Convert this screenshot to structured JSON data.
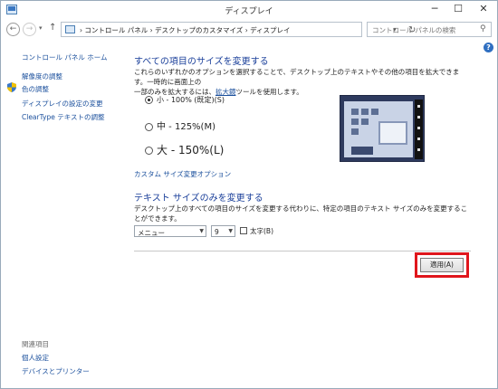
{
  "window": {
    "title": "ディスプレイ",
    "controls": {
      "minimize": "─",
      "maximize": "☐",
      "close": "✕"
    }
  },
  "nav": {
    "back": "←",
    "forward": "→",
    "up": "↑",
    "address": "›  コントロール パネル  ›  デスクトップのカスタマイズ  ›  ディスプレイ",
    "refresh": "↻",
    "search_placeholder": "コントロール パネルの検索"
  },
  "help": "?",
  "sidebar": {
    "home": "コントロール パネル ホーム",
    "items": [
      {
        "label": "解像度の調整"
      },
      {
        "label": "色の調整"
      },
      {
        "label": "ディスプレイの設定の変更"
      },
      {
        "label": "ClearType テキストの調整"
      }
    ],
    "related_caption": "関連項目",
    "related": [
      {
        "label": "個人設定"
      },
      {
        "label": "デバイスとプリンター"
      }
    ]
  },
  "size_section": {
    "heading": "すべての項目のサイズを変更する",
    "desc_line1": "これらのいずれかのオプションを選択することで、デスクトップ上のテキストやその他の項目を拡大できます。一時的に画面上の",
    "desc_line2_pre": "一部のみを拡大するには、",
    "desc_link": "拡大鏡",
    "desc_line2_post": "ツールを使用します。",
    "options": [
      {
        "label": "小 - 100% (既定)(S)",
        "checked": true
      },
      {
        "label": "中 - 125%(M)",
        "checked": false
      },
      {
        "label": "大 - 150%(L)",
        "checked": false
      }
    ],
    "custom_link": "カスタム サイズ変更オプション"
  },
  "text_section": {
    "heading": "テキスト サイズのみを変更する",
    "desc": "デスクトップ上のすべての項目のサイズを変更する代わりに、特定の項目のテキスト サイズのみを変更することができます。",
    "item_select": "メニュー",
    "size_select": "9",
    "bold_label": "太字(B)",
    "bold_checked": false
  },
  "apply_label": "適用(A)",
  "colors": {
    "accent_link": "#1a4f9c",
    "heading": "#1a3f9a",
    "highlight": "#e0161c"
  }
}
